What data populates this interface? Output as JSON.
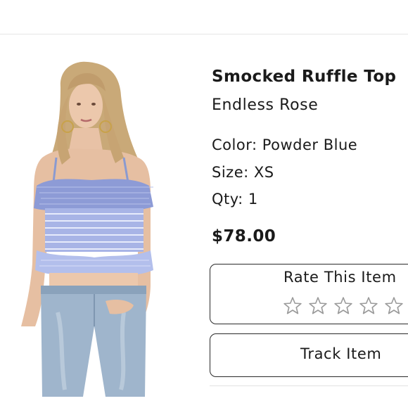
{
  "product": {
    "name": "Smocked Ruffle Top",
    "brand": "Endless Rose",
    "color": "Color: Powder Blue",
    "size": "Size: XS",
    "qty": "Qty: 1",
    "price": "$78.00"
  },
  "rating": {
    "label": "Rate This Item",
    "stars": 5,
    "value": 0
  },
  "actions": {
    "track_label": "Track Item"
  },
  "icons": {
    "star": "star-outline-icon"
  },
  "colors": {
    "text": "#1a1a1a",
    "border": "#2a2a2a",
    "star": "#9a9a9a"
  }
}
